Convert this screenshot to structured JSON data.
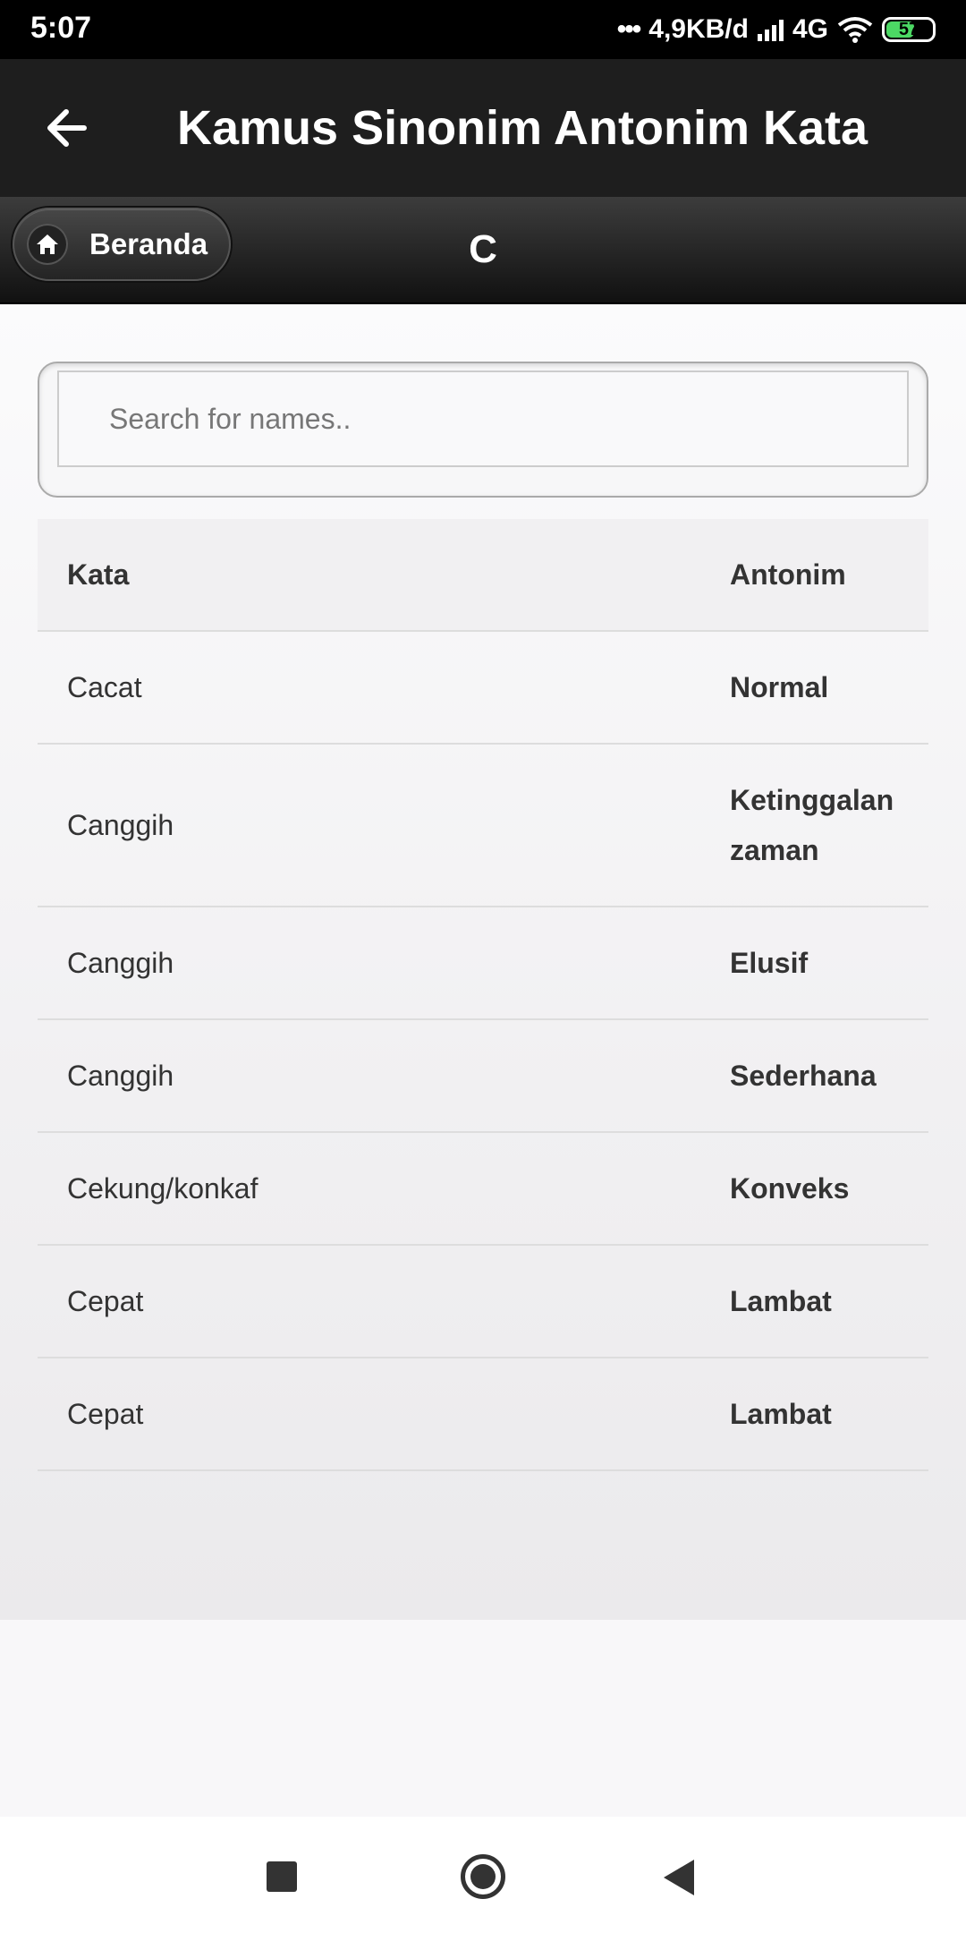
{
  "status_bar": {
    "time": "5:07",
    "dots": "•••",
    "net_speed": "4,9KB/d",
    "network": "4G",
    "battery": "57"
  },
  "appbar": {
    "title": "Kamus Sinonim Antonim Kata",
    "back_icon": "arrow-left-icon"
  },
  "subheader": {
    "home_label": "Beranda",
    "home_icon": "home-icon",
    "title": "C"
  },
  "search": {
    "placeholder": "Search for names.."
  },
  "table": {
    "headers": {
      "kata": "Kata",
      "antonim": "Antonim"
    },
    "rows": [
      {
        "kata": "Cacat",
        "antonim": "Normal"
      },
      {
        "kata": "Canggih",
        "antonim": "Ketinggalan zaman"
      },
      {
        "kata": "Canggih",
        "antonim": "Elusif"
      },
      {
        "kata": "Canggih",
        "antonim": "Sederhana"
      },
      {
        "kata": "Cekung/konkaf",
        "antonim": "Konveks"
      },
      {
        "kata": "Cepat",
        "antonim": "Lambat"
      },
      {
        "kata": "Cepat",
        "antonim": "Lambat"
      }
    ]
  },
  "colors": {
    "statusbar_bg": "#000000",
    "appbar_bg": "#1e1e1e",
    "battery_green": "#4cd964"
  }
}
